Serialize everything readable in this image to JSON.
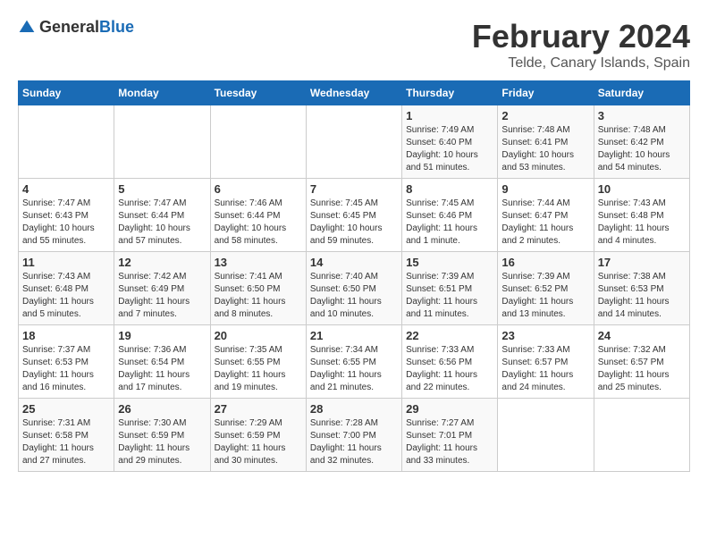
{
  "header": {
    "logo_general": "General",
    "logo_blue": "Blue",
    "month_year": "February 2024",
    "location": "Telde, Canary Islands, Spain"
  },
  "days_of_week": [
    "Sunday",
    "Monday",
    "Tuesday",
    "Wednesday",
    "Thursday",
    "Friday",
    "Saturday"
  ],
  "weeks": [
    [
      {
        "day": "",
        "info": ""
      },
      {
        "day": "",
        "info": ""
      },
      {
        "day": "",
        "info": ""
      },
      {
        "day": "",
        "info": ""
      },
      {
        "day": "1",
        "info": "Sunrise: 7:49 AM\nSunset: 6:40 PM\nDaylight: 10 hours and 51 minutes."
      },
      {
        "day": "2",
        "info": "Sunrise: 7:48 AM\nSunset: 6:41 PM\nDaylight: 10 hours and 53 minutes."
      },
      {
        "day": "3",
        "info": "Sunrise: 7:48 AM\nSunset: 6:42 PM\nDaylight: 10 hours and 54 minutes."
      }
    ],
    [
      {
        "day": "4",
        "info": "Sunrise: 7:47 AM\nSunset: 6:43 PM\nDaylight: 10 hours and 55 minutes."
      },
      {
        "day": "5",
        "info": "Sunrise: 7:47 AM\nSunset: 6:44 PM\nDaylight: 10 hours and 57 minutes."
      },
      {
        "day": "6",
        "info": "Sunrise: 7:46 AM\nSunset: 6:44 PM\nDaylight: 10 hours and 58 minutes."
      },
      {
        "day": "7",
        "info": "Sunrise: 7:45 AM\nSunset: 6:45 PM\nDaylight: 10 hours and 59 minutes."
      },
      {
        "day": "8",
        "info": "Sunrise: 7:45 AM\nSunset: 6:46 PM\nDaylight: 11 hours and 1 minute."
      },
      {
        "day": "9",
        "info": "Sunrise: 7:44 AM\nSunset: 6:47 PM\nDaylight: 11 hours and 2 minutes."
      },
      {
        "day": "10",
        "info": "Sunrise: 7:43 AM\nSunset: 6:48 PM\nDaylight: 11 hours and 4 minutes."
      }
    ],
    [
      {
        "day": "11",
        "info": "Sunrise: 7:43 AM\nSunset: 6:48 PM\nDaylight: 11 hours and 5 minutes."
      },
      {
        "day": "12",
        "info": "Sunrise: 7:42 AM\nSunset: 6:49 PM\nDaylight: 11 hours and 7 minutes."
      },
      {
        "day": "13",
        "info": "Sunrise: 7:41 AM\nSunset: 6:50 PM\nDaylight: 11 hours and 8 minutes."
      },
      {
        "day": "14",
        "info": "Sunrise: 7:40 AM\nSunset: 6:50 PM\nDaylight: 11 hours and 10 minutes."
      },
      {
        "day": "15",
        "info": "Sunrise: 7:39 AM\nSunset: 6:51 PM\nDaylight: 11 hours and 11 minutes."
      },
      {
        "day": "16",
        "info": "Sunrise: 7:39 AM\nSunset: 6:52 PM\nDaylight: 11 hours and 13 minutes."
      },
      {
        "day": "17",
        "info": "Sunrise: 7:38 AM\nSunset: 6:53 PM\nDaylight: 11 hours and 14 minutes."
      }
    ],
    [
      {
        "day": "18",
        "info": "Sunrise: 7:37 AM\nSunset: 6:53 PM\nDaylight: 11 hours and 16 minutes."
      },
      {
        "day": "19",
        "info": "Sunrise: 7:36 AM\nSunset: 6:54 PM\nDaylight: 11 hours and 17 minutes."
      },
      {
        "day": "20",
        "info": "Sunrise: 7:35 AM\nSunset: 6:55 PM\nDaylight: 11 hours and 19 minutes."
      },
      {
        "day": "21",
        "info": "Sunrise: 7:34 AM\nSunset: 6:55 PM\nDaylight: 11 hours and 21 minutes."
      },
      {
        "day": "22",
        "info": "Sunrise: 7:33 AM\nSunset: 6:56 PM\nDaylight: 11 hours and 22 minutes."
      },
      {
        "day": "23",
        "info": "Sunrise: 7:33 AM\nSunset: 6:57 PM\nDaylight: 11 hours and 24 minutes."
      },
      {
        "day": "24",
        "info": "Sunrise: 7:32 AM\nSunset: 6:57 PM\nDaylight: 11 hours and 25 minutes."
      }
    ],
    [
      {
        "day": "25",
        "info": "Sunrise: 7:31 AM\nSunset: 6:58 PM\nDaylight: 11 hours and 27 minutes."
      },
      {
        "day": "26",
        "info": "Sunrise: 7:30 AM\nSunset: 6:59 PM\nDaylight: 11 hours and 29 minutes."
      },
      {
        "day": "27",
        "info": "Sunrise: 7:29 AM\nSunset: 6:59 PM\nDaylight: 11 hours and 30 minutes."
      },
      {
        "day": "28",
        "info": "Sunrise: 7:28 AM\nSunset: 7:00 PM\nDaylight: 11 hours and 32 minutes."
      },
      {
        "day": "29",
        "info": "Sunrise: 7:27 AM\nSunset: 7:01 PM\nDaylight: 11 hours and 33 minutes."
      },
      {
        "day": "",
        "info": ""
      },
      {
        "day": "",
        "info": ""
      }
    ]
  ]
}
